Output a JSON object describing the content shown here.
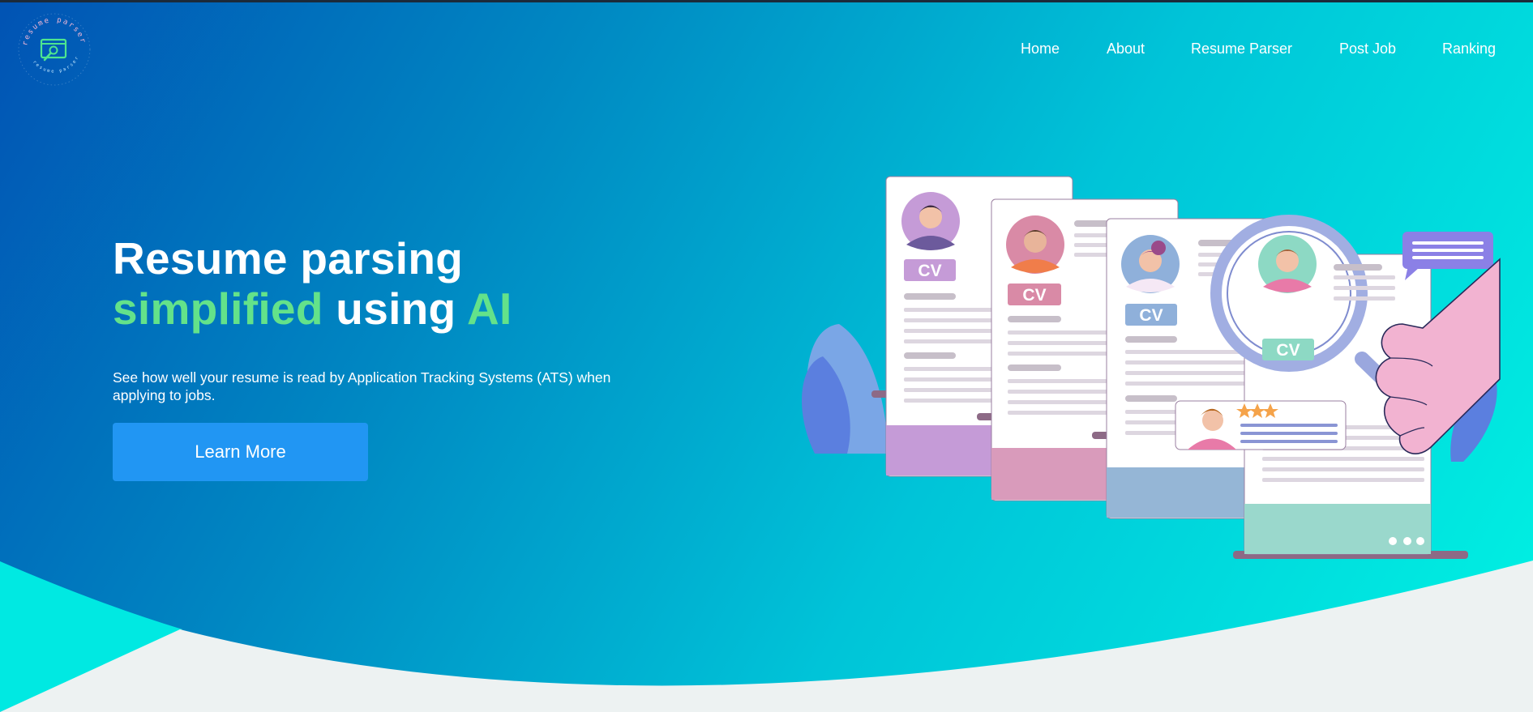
{
  "colors": {
    "gradient_start": "#0153b4",
    "gradient_end": "#00f3e3",
    "accent_green": "#63e28a",
    "button_blue": "#2196f3"
  },
  "logo": {
    "ring_text_top": "resume parser",
    "ring_text_bottom": "resume parser",
    "icon": "resume-search-icon"
  },
  "nav": {
    "items": [
      {
        "label": "Home"
      },
      {
        "label": "About"
      },
      {
        "label": "Resume Parser"
      },
      {
        "label": "Post Job"
      },
      {
        "label": "Ranking"
      }
    ]
  },
  "hero": {
    "title_line1": "Resume parsing",
    "title_word_green1": "simplified",
    "title_word_white": " using ",
    "title_word_green2": "AI",
    "description": "See how well your resume is read by Application Tracking Systems (ATS) when applying to jobs.",
    "cta_label": "Learn More"
  },
  "illustration": {
    "card_label": "CV",
    "rating_stars": 3
  }
}
